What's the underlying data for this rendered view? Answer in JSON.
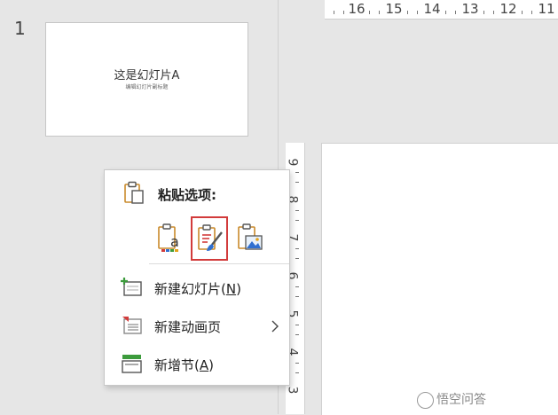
{
  "thumbnail_pane": {
    "slide_number": "1",
    "slide_title": "这是幻灯片A",
    "slide_subtitle": "编辑幻灯片副标题"
  },
  "ruler_top": {
    "labels": [
      "16",
      "15",
      "14",
      "13",
      "12",
      "11"
    ]
  },
  "ruler_left": {
    "labels": [
      "9",
      "8",
      "7",
      "6",
      "5",
      "4",
      "3"
    ]
  },
  "context_menu": {
    "paste_label": "粘贴选项:",
    "paste_options": [
      {
        "name": "keep-text-only",
        "icon": "paste-text-icon",
        "selected": false
      },
      {
        "name": "use-destination-theme",
        "icon": "paste-brush-icon",
        "selected": true
      },
      {
        "name": "picture",
        "icon": "paste-picture-icon",
        "selected": false
      }
    ],
    "items": [
      {
        "label": "新建幻灯片(",
        "key": "N",
        "suffix": ")",
        "icon": "new-slide-icon",
        "has_submenu": false
      },
      {
        "label": "新建动画页",
        "key": "",
        "suffix": "",
        "icon": "new-animation-page-icon",
        "has_submenu": true
      },
      {
        "label": "新增节(",
        "key": "A",
        "suffix": ")",
        "icon": "new-section-icon",
        "has_submenu": false
      }
    ],
    "selection_color": "#d23b3b"
  },
  "watermark": {
    "text": "悟空问答"
  }
}
